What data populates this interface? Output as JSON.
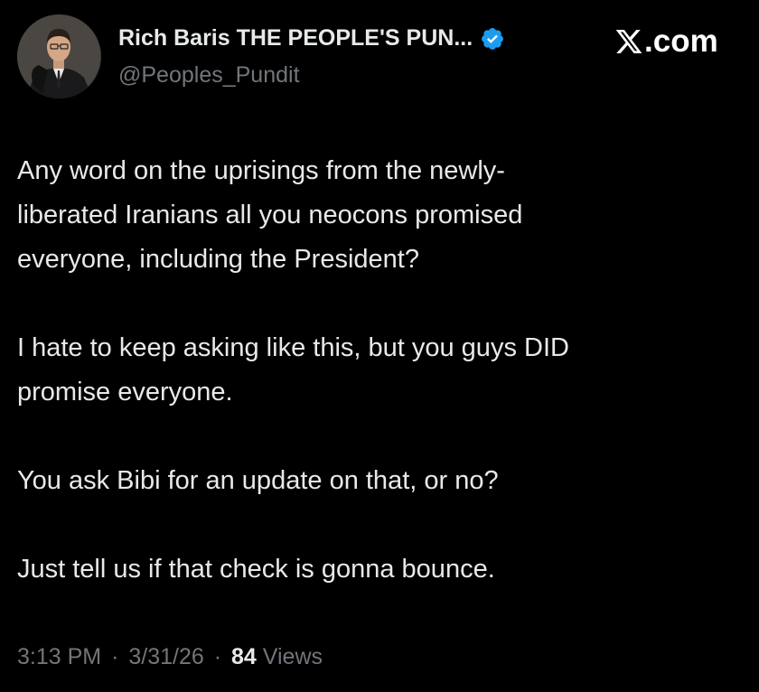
{
  "author": {
    "display_name": "Rich Baris THE PEOPLE'S PUN...",
    "handle": "@Peoples_Pundit",
    "verified": true,
    "verified_color": "#1d9bf0"
  },
  "brand": {
    "label": ".com",
    "icon": "x-logo-icon"
  },
  "tweet": {
    "paragraphs": [
      "Any word on the uprisings from the newly-\nliberated Iranians all you neocons promised\neveryone, including the President?",
      "I hate to keep asking like this, but you guys DID\npromise everyone.",
      "You ask Bibi for an update on that, or no?",
      "Just tell us if that check is gonna bounce."
    ]
  },
  "meta": {
    "time": "3:13 PM",
    "separator": "·",
    "date": "3/31/26",
    "views_count": "84",
    "views_label": "Views"
  },
  "colors": {
    "background": "#000000",
    "text_primary": "#e7e9ea",
    "text_secondary": "#71767b"
  }
}
